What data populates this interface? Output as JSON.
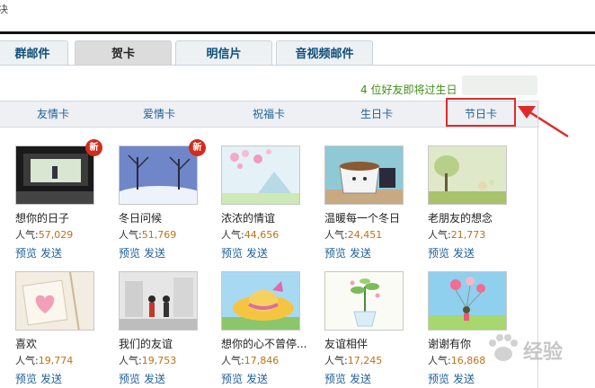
{
  "window": {
    "top_fragment": "决"
  },
  "tabs": [
    {
      "label": "群邮件"
    },
    {
      "label": "贺卡"
    },
    {
      "label": "明信片"
    },
    {
      "label": "音视频邮件"
    }
  ],
  "info": {
    "birthday_notice": "4 位好友即将过生日"
  },
  "categories": [
    {
      "label": "友情卡"
    },
    {
      "label": "爱情卡"
    },
    {
      "label": "祝福卡"
    },
    {
      "label": "生日卡"
    },
    {
      "label": "节日卡"
    }
  ],
  "labels": {
    "popularity": "人气:",
    "preview": "预览",
    "send": "发送",
    "new_badge": "新"
  },
  "cards": [
    {
      "title": "想你的日子",
      "popularity": "57,029",
      "is_new": true
    },
    {
      "title": "冬日问候",
      "popularity": "51,769",
      "is_new": true
    },
    {
      "title": "浓浓的情谊",
      "popularity": "44,656",
      "is_new": false
    },
    {
      "title": "温暖每一个冬日",
      "popularity": "24,451",
      "is_new": false
    },
    {
      "title": "老朋友的想念",
      "popularity": "21,773",
      "is_new": false
    },
    {
      "title": "喜欢",
      "popularity": "19,774",
      "is_new": false
    },
    {
      "title": "我们的友谊",
      "popularity": "19,753",
      "is_new": false
    },
    {
      "title": "想你的心不曾停...",
      "popularity": "17,846",
      "is_new": false
    },
    {
      "title": "友谊相伴",
      "popularity": "17,245",
      "is_new": false
    },
    {
      "title": "谢谢有你",
      "popularity": "16,868",
      "is_new": false
    }
  ],
  "watermark": {
    "text": "经验"
  },
  "colors": {
    "highlight": "#e02a2a",
    "link": "#1f5f9a",
    "count": "#c07014",
    "notice": "#3d8f13"
  }
}
